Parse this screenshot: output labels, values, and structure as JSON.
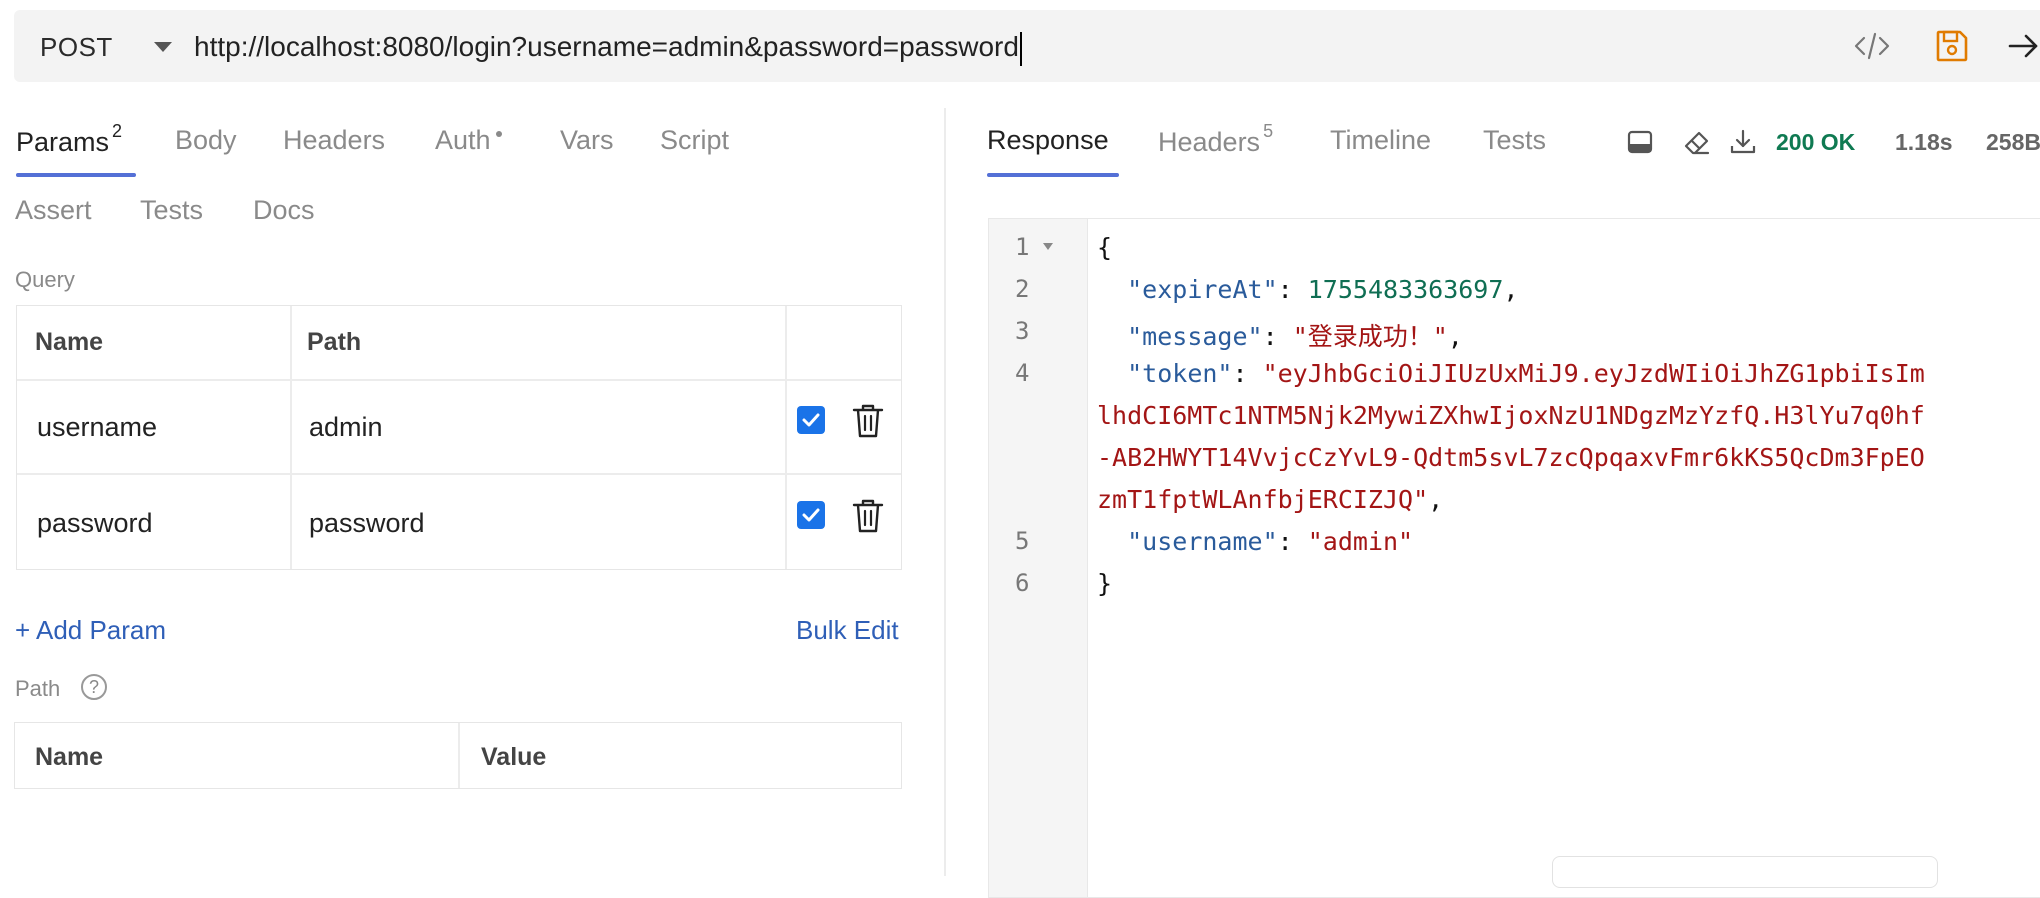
{
  "request": {
    "method": "POST",
    "url": "http://localhost:8080/login?username=admin&password=password"
  },
  "request_tabs": [
    {
      "label": "Params",
      "badge": "2"
    },
    {
      "label": "Body"
    },
    {
      "label": "Headers"
    },
    {
      "label": "Auth"
    },
    {
      "label": "Vars"
    },
    {
      "label": "Script"
    },
    {
      "label": "Assert"
    },
    {
      "label": "Tests"
    },
    {
      "label": "Docs"
    }
  ],
  "query": {
    "label": "Query",
    "headers": [
      "Name",
      "Path"
    ],
    "rows": [
      {
        "name": "username",
        "value": "admin",
        "enabled": true
      },
      {
        "name": "password",
        "value": "password",
        "enabled": true
      }
    ],
    "add_label": "+ Add Param",
    "bulk_label": "Bulk Edit"
  },
  "path": {
    "label": "Path",
    "help": "?",
    "headers": [
      "Name",
      "Value"
    ]
  },
  "response_tabs": [
    {
      "label": "Response"
    },
    {
      "label": "Headers",
      "badge": "5"
    },
    {
      "label": "Timeline"
    },
    {
      "label": "Tests"
    }
  ],
  "status": {
    "code": "200 OK",
    "time": "1.18s",
    "size": "258B"
  },
  "response_body": {
    "line_numbers": [
      "1",
      "2",
      "3",
      "4",
      "5",
      "6"
    ],
    "open_brace": "{",
    "close_brace": "}",
    "expireAt_key": "\"expireAt\"",
    "expireAt_value": "1755483363697",
    "message_key": "\"message\"",
    "message_value": "\"登录成功！\"",
    "token_key": "\"token\"",
    "token_line1": "\"eyJhbGciOiJIUzUxMiJ9.eyJzdWIiOiJhZG1pbiIsIm",
    "token_line2": "lhdCI6MTc1NTM5Njk2MywiZXhwIjoxNzU1NDgzMzYzfQ.H3lYu7q0hf",
    "token_line3": "-AB2HWYT14VvjcCzYvL9-Qdtm5svL7zcQpqaxvFmr6kKS5QcDm3FpEO",
    "token_line4": "zmT1fptWLAnfbjERCIZJQ\"",
    "username_key": "\"username\"",
    "username_value": "\"admin\""
  },
  "colors": {
    "accent": "#5470d6",
    "status_ok": "#0f7a52",
    "save": "#e07b00",
    "checkbox": "#1a73e8"
  }
}
